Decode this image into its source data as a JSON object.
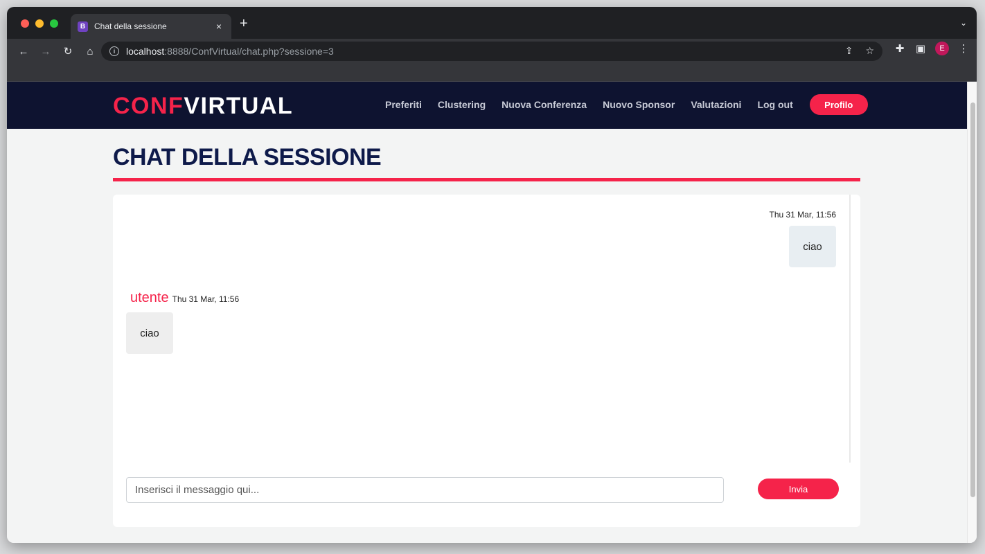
{
  "browser": {
    "tab_icon_letter": "B",
    "tab_title": "Chat della sessione",
    "tab_close": "×",
    "new_tab": "+",
    "tab_menu": "⌄",
    "url_host": "localhost",
    "url_rest": ":8888/ConfVirtual/chat.php?sessione=3",
    "profile_letter": "E",
    "nav": {
      "back": "←",
      "forward": "→",
      "reload": "↻",
      "home": "⌂",
      "info": "i"
    },
    "omni_icons": {
      "share": "⇪",
      "star": "☆"
    },
    "toolbar_icons": {
      "extensions": "✚",
      "sidebar": "▣",
      "menu": "⋮"
    }
  },
  "site": {
    "brand_part1": "CONF",
    "brand_part2": "VIRTUAL",
    "menu": [
      "Preferiti",
      "Clustering",
      "Nuova Conferenza",
      "Nuovo Sponsor",
      "Valutazioni",
      "Log out"
    ],
    "profile_label": "Profilo"
  },
  "page": {
    "title": "CHAT DELLA SESSIONE"
  },
  "chat": {
    "messages": [
      {
        "side": "right",
        "time": "Thu 31 Mar, 11:56",
        "text": "ciao"
      },
      {
        "side": "left",
        "user": "utente",
        "time": "Thu 31 Mar, 11:56",
        "text": "ciao"
      }
    ],
    "input_placeholder": "Inserisci il messaggio qui...",
    "send_label": "Invia"
  },
  "colors": {
    "accent": "#f5234a",
    "navbar": "#0e1330",
    "title": "#0e1a4a"
  }
}
